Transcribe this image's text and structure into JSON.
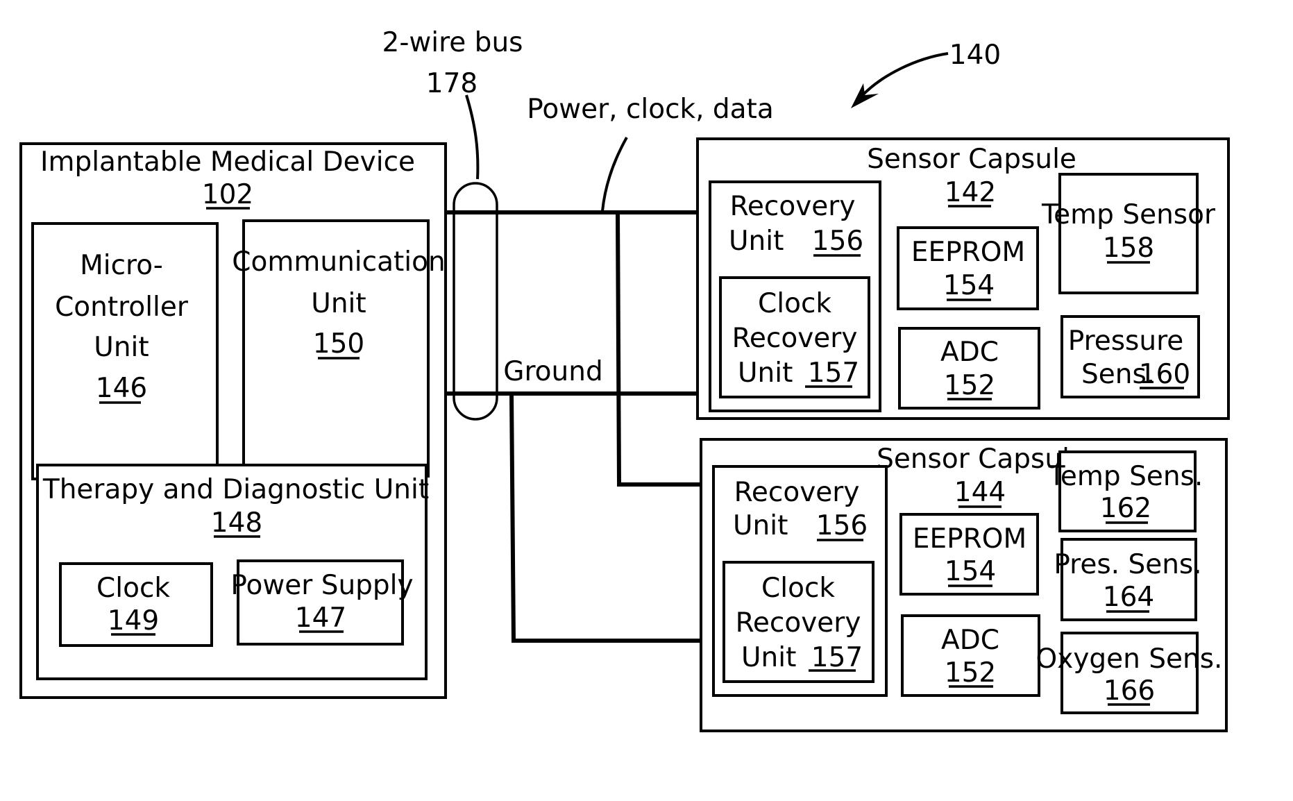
{
  "figure": {
    "reference": "140",
    "bus": {
      "label": "2-wire bus",
      "number": "178",
      "top_wire_label": "Power, clock, data",
      "bottom_wire_label": "Ground"
    },
    "implantable_device": {
      "title": "Implantable Medical Device",
      "number": "102",
      "microcontroller": {
        "lines": [
          "Micro-",
          "Controller",
          "Unit"
        ],
        "number": "146"
      },
      "communication": {
        "lines": [
          "Communication",
          "Unit"
        ],
        "number": "150"
      },
      "therapy": {
        "title": "Therapy and Diagnostic Unit",
        "number": "148",
        "clock": {
          "label": "Clock",
          "number": "149"
        },
        "power_supply": {
          "label": "Power Supply",
          "number": "147"
        }
      }
    },
    "capsule_142": {
      "title": "Sensor Capsule",
      "number": "142",
      "recovery_unit": {
        "line1": "Recovery",
        "line2": "Unit",
        "number": "156"
      },
      "clock_recovery": {
        "line1": "Clock",
        "line2": "Recovery",
        "line3": "Unit",
        "number": "157"
      },
      "eeprom": {
        "label": "EEPROM",
        "number": "154"
      },
      "adc": {
        "label": "ADC",
        "number": "152"
      },
      "temp": {
        "label": "Temp Sensor",
        "number": "158"
      },
      "pressure": {
        "line1": "Pressure",
        "line2": "Sens.",
        "number": "160"
      }
    },
    "capsule_144": {
      "title": "Sensor Capsule",
      "number": "144",
      "recovery_unit": {
        "line1": "Recovery",
        "line2": "Unit",
        "number": "156"
      },
      "clock_recovery": {
        "line1": "Clock",
        "line2": "Recovery",
        "line3": "Unit",
        "number": "157"
      },
      "eeprom": {
        "label": "EEPROM",
        "number": "154"
      },
      "adc": {
        "label": "ADC",
        "number": "152"
      },
      "temp": {
        "label": "Temp Sens.",
        "number": "162"
      },
      "pressure": {
        "label": "Pres. Sens.",
        "number": "164"
      },
      "oxygen": {
        "label": "Oxygen Sens.",
        "number": "166"
      }
    }
  }
}
